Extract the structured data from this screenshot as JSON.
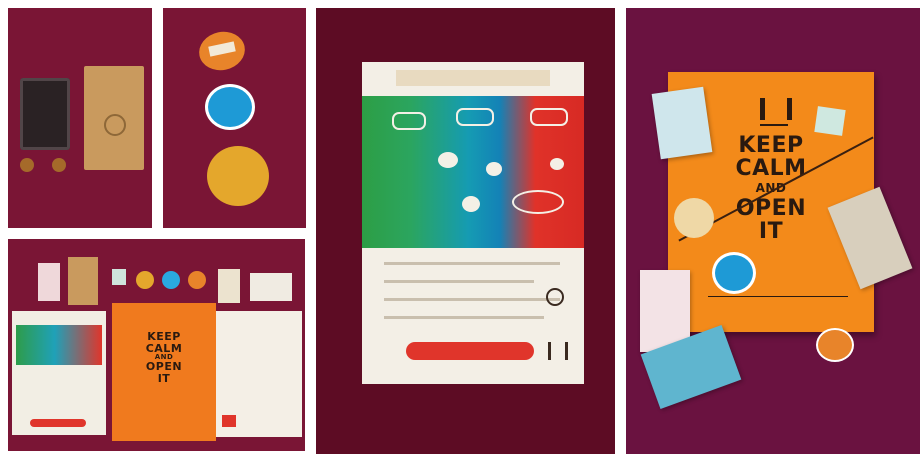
{
  "collage": {
    "background": "#ffffff",
    "panel_color": "#7a1535"
  },
  "poster": {
    "line1": "KEEP",
    "line2": "CALM",
    "line3": "AND",
    "line4": "OPEN",
    "line5": "IT"
  },
  "small_poster": {
    "line1": "KEEP",
    "line2": "CALM",
    "line3": "AND",
    "line4": "OPEN",
    "line5": "IT"
  }
}
